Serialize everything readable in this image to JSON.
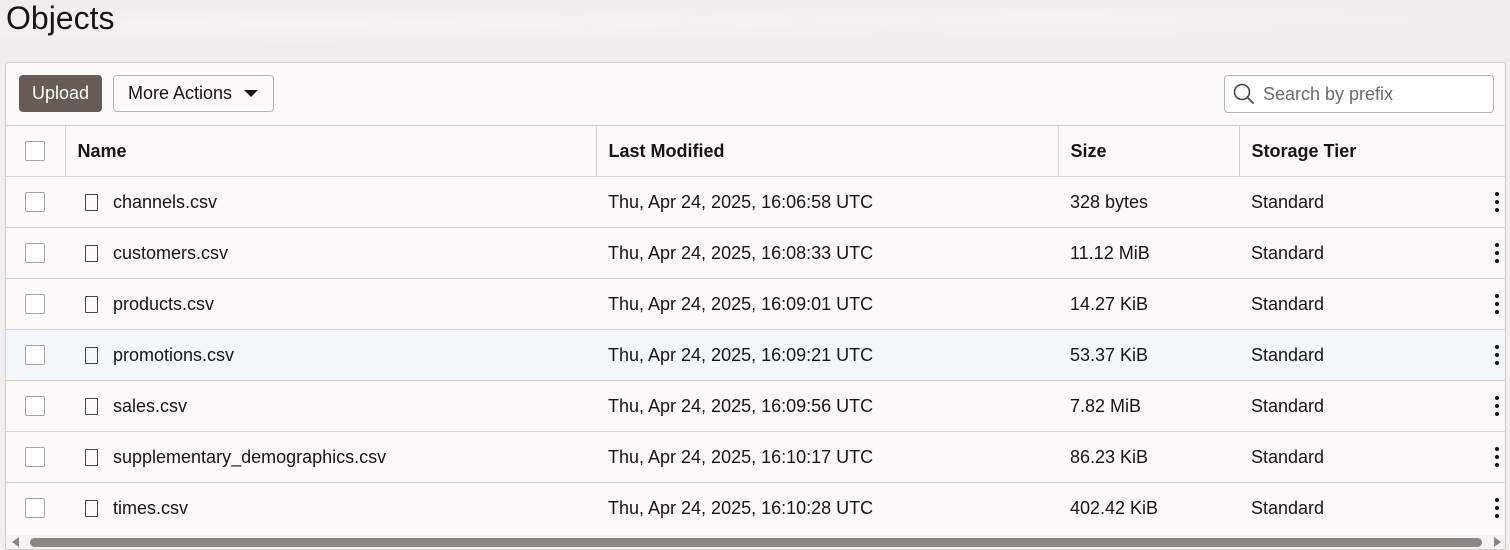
{
  "page": {
    "title": "Objects"
  },
  "toolbar": {
    "upload_label": "Upload",
    "more_actions_label": "More Actions",
    "search_placeholder": "Search by prefix",
    "search_value": ""
  },
  "table": {
    "columns": [
      "Name",
      "Last Modified",
      "Size",
      "Storage Tier"
    ],
    "rows": [
      {
        "name": "channels.csv",
        "last_modified": "Thu, Apr 24, 2025, 16:06:58 UTC",
        "size": "328 bytes",
        "tier": "Standard"
      },
      {
        "name": "customers.csv",
        "last_modified": "Thu, Apr 24, 2025, 16:08:33 UTC",
        "size": "11.12 MiB",
        "tier": "Standard"
      },
      {
        "name": "products.csv",
        "last_modified": "Thu, Apr 24, 2025, 16:09:01 UTC",
        "size": "14.27 KiB",
        "tier": "Standard"
      },
      {
        "name": "promotions.csv",
        "last_modified": "Thu, Apr 24, 2025, 16:09:21 UTC",
        "size": "53.37 KiB",
        "tier": "Standard"
      },
      {
        "name": "sales.csv",
        "last_modified": "Thu, Apr 24, 2025, 16:09:56 UTC",
        "size": "7.82 MiB",
        "tier": "Standard"
      },
      {
        "name": "supplementary_demographics.csv",
        "last_modified": "Thu, Apr 24, 2025, 16:10:17 UTC",
        "size": "86.23 KiB",
        "tier": "Standard"
      },
      {
        "name": "times.csv",
        "last_modified": "Thu, Apr 24, 2025, 16:10:28 UTC",
        "size": "402.42 KiB",
        "tier": "Standard"
      }
    ],
    "highlighted_row": "promotions.csv"
  },
  "icons": {
    "search": "search-icon",
    "file": "file-icon",
    "row_actions": "kebab-menu-icon",
    "dropdown": "caret-down-icon"
  },
  "colors": {
    "primary_button": "#665c55",
    "row_highlight": "#f2f7fb"
  }
}
